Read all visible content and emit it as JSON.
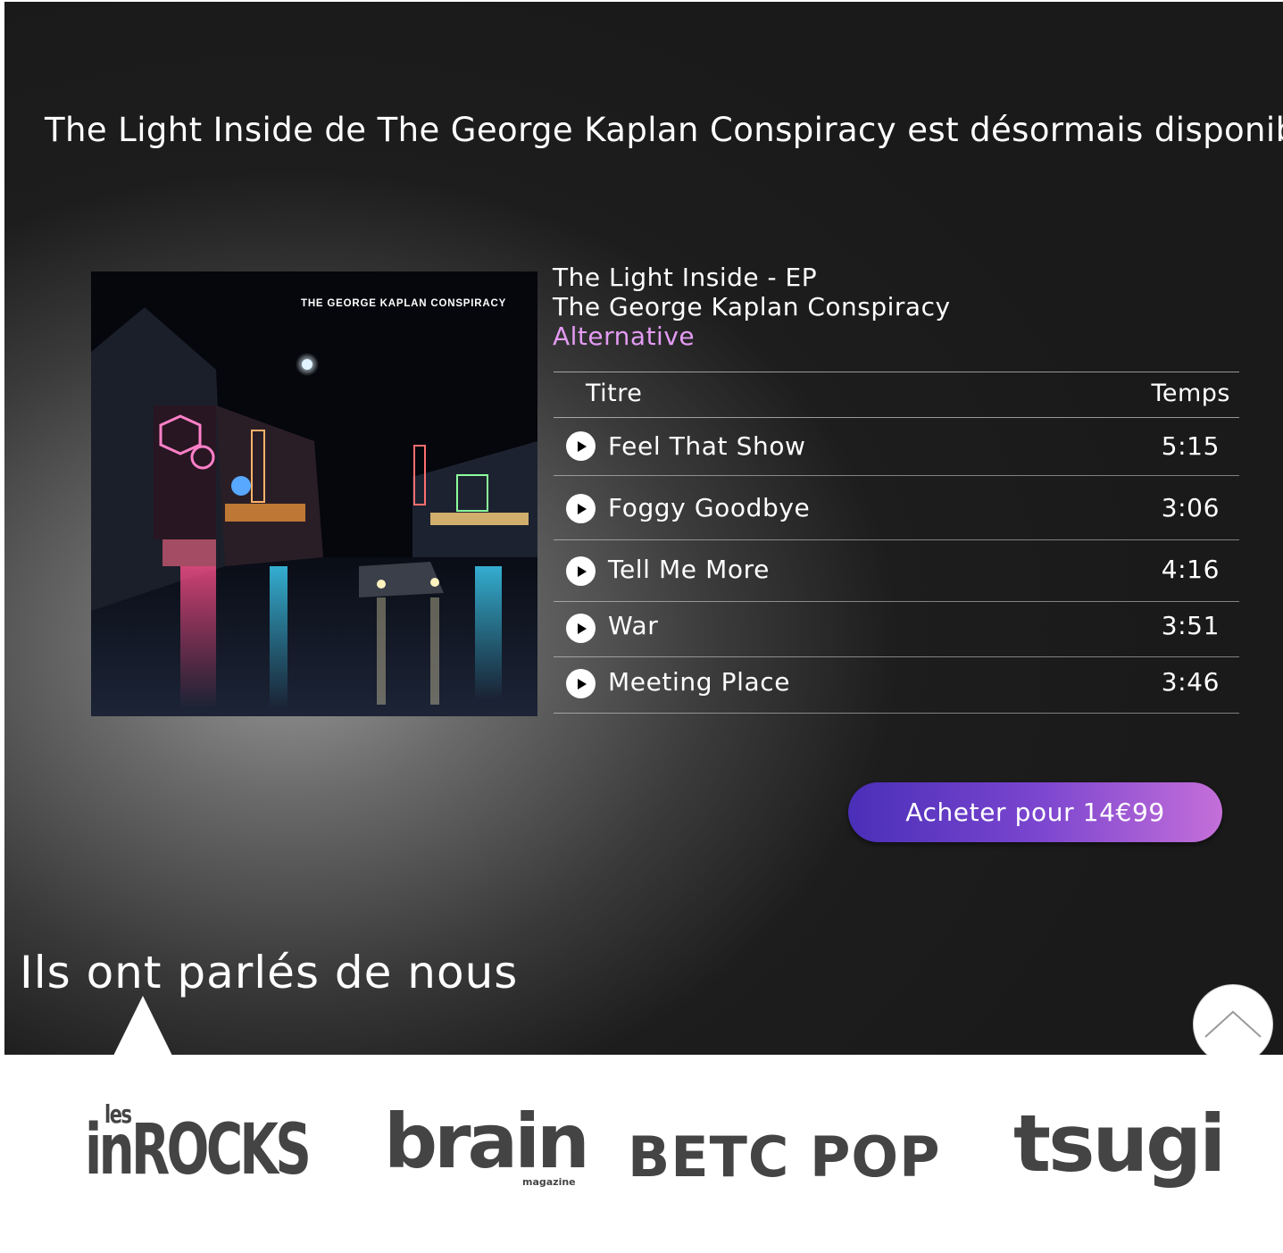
{
  "announcement": "The Light Inside de The George Kaplan Conspiracy est désormais disponible",
  "album": {
    "cover_text": "THE GEORGE KAPLAN CONSPIRACY",
    "title": "The Light Inside - EP",
    "artist": "The George Kaplan Conspiracy",
    "genre": "Alternative"
  },
  "tracklist": {
    "headers": {
      "title": "Titre",
      "time": "Temps"
    },
    "tracks": [
      {
        "name": "Feel That Show",
        "time": "5:15"
      },
      {
        "name": "Foggy Goodbye",
        "time": "3:06"
      },
      {
        "name": "Tell Me More",
        "time": "4:16"
      },
      {
        "name": "War",
        "time": "3:51"
      },
      {
        "name": "Meeting Place",
        "time": "3:46"
      }
    ]
  },
  "buy_button": "Acheter pour 14€99",
  "press": {
    "heading": "Ils ont parlés de nous",
    "logos": {
      "inrocks": {
        "small": "les",
        "main": "inROCKS"
      },
      "brain": {
        "main": "brain",
        "sub": "magazine"
      },
      "betc": "BETC POP",
      "tsugi": "tsugi"
    }
  },
  "icons": {
    "play": "play-icon",
    "scroll_top": "chevron-up-icon"
  },
  "colors": {
    "genre": "#e39bf2",
    "button_gradient_start": "#4a2fb8",
    "button_gradient_end": "#c46fd9",
    "logo_gray": "#444444"
  }
}
